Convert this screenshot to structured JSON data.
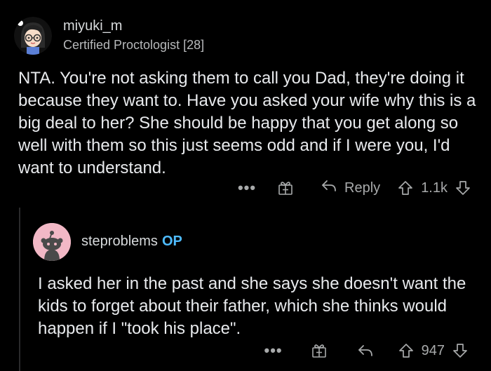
{
  "comment1": {
    "username": "miyuki_m",
    "flair": "Certified Proctologist [28]",
    "body": "NTA. You're not asking them to call you Dad, they're doing it because they want to. Have you asked your wife why this is a big deal to her? She should be happy that you get along so well with them so this just seems odd and if I were you, I'd want to understand.",
    "actions": {
      "more": "•••",
      "reply": "Reply",
      "score": "1.1k"
    }
  },
  "comment2": {
    "username": "steproblems",
    "op_badge": "OP",
    "body": "I asked her in the past and she says she doesn't want the kids to forget about their father, which she thinks would happen if I \"took his place\".",
    "actions": {
      "more": "•••",
      "score": "947"
    }
  },
  "colors": {
    "background": "#000000",
    "op_badge": "#4fbcff",
    "text": "#e8eaed",
    "muted": "#a8aaab"
  }
}
